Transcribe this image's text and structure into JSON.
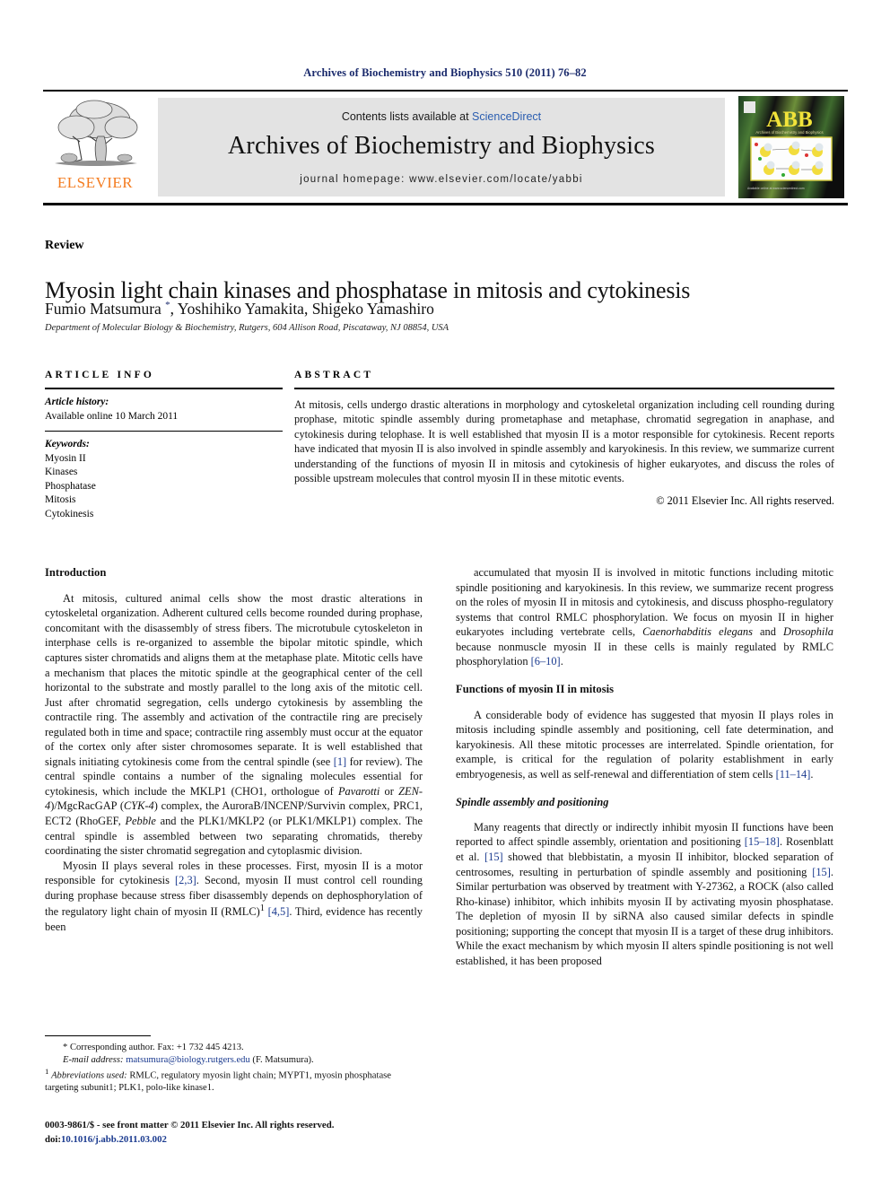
{
  "running_head": "Archives of Biochemistry and Biophysics 510 (2011) 76–82",
  "masthead": {
    "publisher_name": "ELSEVIER",
    "contents_prefix": "Contents lists available at ",
    "contents_link": "ScienceDirect",
    "journal_title": "Archives of Biochemistry and Biophysics",
    "homepage": "journal homepage: www.elsevier.com/locate/yabbi",
    "cover_title": "ABB",
    "cover_subtitle": "Archives of Biochemistry and Biophysics"
  },
  "article": {
    "section_type": "Review",
    "title": "Myosin light chain kinases and phosphatase in mitosis and cytokinesis",
    "authors": "Fumio Matsumura *, Yoshihiko Yamakita, Shigeko Yamashiro",
    "affiliation": "Department of Molecular Biology & Biochemistry, Rutgers, 604 Allison Road, Piscataway, NJ 08854, USA"
  },
  "article_info": {
    "heading": "ARTICLE INFO",
    "history_label": "Article history:",
    "history_value": "Available online 10 March 2011",
    "keywords_label": "Keywords:",
    "keywords": [
      "Myosin II",
      "Kinases",
      "Phosphatase",
      "Mitosis",
      "Cytokinesis"
    ]
  },
  "abstract": {
    "heading": "ABSTRACT",
    "text": "At mitosis, cells undergo drastic alterations in morphology and cytoskeletal organization including cell rounding during prophase, mitotic spindle assembly during prometaphase and metaphase, chromatid segregation in anaphase, and cytokinesis during telophase. It is well established that myosin II is a motor responsible for cytokinesis. Recent reports have indicated that myosin II is also involved in spindle assembly and karyokinesis. In this review, we summarize current understanding of the functions of myosin II in mitosis and cytokinesis of higher eukaryotes, and discuss the roles of possible upstream molecules that control myosin II in these mitotic events.",
    "copyright": "© 2011 Elsevier Inc. All rights reserved."
  },
  "body": {
    "intro_heading": "Introduction",
    "intro_p1_a": "At mitosis, cultured animal cells show the most drastic alterations in cytoskeletal organization. Adherent cultured cells become rounded during prophase, concomitant with the disassembly of stress fibers. The microtubule cytoskeleton in interphase cells is re-organized to assemble the bipolar mitotic spindle, which captures sister chromatids and aligns them at the metaphase plate. Mitotic cells have a mechanism that places the mitotic spindle at the geographical center of the cell horizontal to the substrate and mostly parallel to the long axis of the mitotic cell. Just after chromatid segregation, cells undergo cytokinesis by assembling the contractile ring. The assembly and activation of the contractile ring are precisely regulated both in time and space; contractile ring assembly must occur at the equator of the cortex only after sister chromosomes separate. It is well established that signals initiating cytokinesis come from the central spindle (see ",
    "intro_p1_ref1": "[1]",
    "intro_p1_b": " for review). The central spindle contains a number of the signaling molecules essential for cytokinesis, which include the MKLP1 (CHO1, orthologue of ",
    "intro_p1_it1": "Pavarotti",
    "intro_p1_c": " or ",
    "intro_p1_it2": "ZEN-4",
    "intro_p1_d": ")/MgcRacGAP (",
    "intro_p1_it3": "CYK-4",
    "intro_p1_e": ") complex, the AuroraB/INCENP/Survivin complex, PRC1, ECT2 (RhoGEF, ",
    "intro_p1_it4": "Pebble",
    "intro_p1_f": " and the PLK1/MKLP2 (or PLK1/MKLP1) complex. The central spindle is assembled between two separating chromatids, thereby coordinating the sister chromatid segregation and cytoplasmic division.",
    "intro_p2_a": "Myosin II plays several roles in these processes. First, myosin II is a motor responsible for cytokinesis ",
    "intro_p2_ref1": "[2,3]",
    "intro_p2_b": ". Second, myosin II must control cell rounding during prophase because stress fiber disassembly depends on dephosphorylation of the regulatory light chain of myosin II (RMLC)",
    "intro_p2_sup": "1",
    "intro_p2_c": " ",
    "intro_p2_ref2": "[4,5]",
    "intro_p2_d": ". Third, evidence has recently been",
    "right_p1_a": "accumulated that myosin II is involved in mitotic functions including mitotic spindle positioning and karyokinesis. In this review, we summarize recent progress on the roles of myosin II in mitosis and cytokinesis, and discuss phospho-regulatory systems that control RMLC phosphorylation. We focus on myosin II in higher eukaryotes including vertebrate cells, ",
    "right_p1_it1": "Caenorhabditis elegans",
    "right_p1_b": " and ",
    "right_p1_it2": "Drosophila",
    "right_p1_c": " because nonmuscle myosin II in these cells is mainly regulated by RMLC phosphorylation ",
    "right_p1_ref1": "[6–10]",
    "right_p1_d": ".",
    "functions_heading": "Functions of myosin II in mitosis",
    "functions_p1_a": "A considerable body of evidence has suggested that myosin II plays roles in mitosis including spindle assembly and positioning, cell fate determination, and karyokinesis. All these mitotic processes are interrelated. Spindle orientation, for example, is critical for the regulation of polarity establishment in early embryogenesis, as well as self-renewal and differentiation of stem cells ",
    "functions_p1_ref1": "[11–14]",
    "functions_p1_b": ".",
    "spindle_heading": "Spindle assembly and positioning",
    "spindle_p1_a": "Many reagents that directly or indirectly inhibit myosin II functions have been reported to affect spindle assembly, orientation and positioning ",
    "spindle_p1_ref1": "[15–18]",
    "spindle_p1_b": ". Rosenblatt et al. ",
    "spindle_p1_ref2": "[15]",
    "spindle_p1_c": " showed that blebbistatin, a myosin II inhibitor, blocked separation of centrosomes, resulting in perturbation of spindle assembly and positioning ",
    "spindle_p1_ref3": "[15]",
    "spindle_p1_d": ". Similar perturbation was observed by treatment with Y-27362, a ROCK (also called Rho-kinase) inhibitor, which inhibits myosin II by activating myosin phosphatase. The depletion of myosin II by siRNA also caused similar defects in spindle positioning; supporting the concept that myosin II is a target of these drug inhibitors. While the exact mechanism by which myosin II alters spindle positioning is not well established, it has been proposed"
  },
  "footnotes": {
    "corresponding": "* Corresponding author. Fax: +1 732 445 4213.",
    "email_label": "E-mail address:",
    "email_value": "matsumura@biology.rutgers.edu",
    "email_suffix": "(F. Matsumura).",
    "abbrev_marker": "1",
    "abbrev_label": "Abbreviations used:",
    "abbrev_text": "RMLC, regulatory myosin light chain; MYPT1, myosin phosphatase targeting subunit1; PLK1, polo-like kinase1."
  },
  "imprint": {
    "line1": "0003-9861/$ - see front matter © 2011 Elsevier Inc. All rights reserved.",
    "doi_label": "doi:",
    "doi_value": "10.1016/j.abb.2011.03.002"
  },
  "colors": {
    "running_head": "#1a2a6c",
    "link": "#2a5db0",
    "reference": "#1a3a8f",
    "elsevier_orange": "#f47c20",
    "gray_box": "#e3e3e3"
  }
}
